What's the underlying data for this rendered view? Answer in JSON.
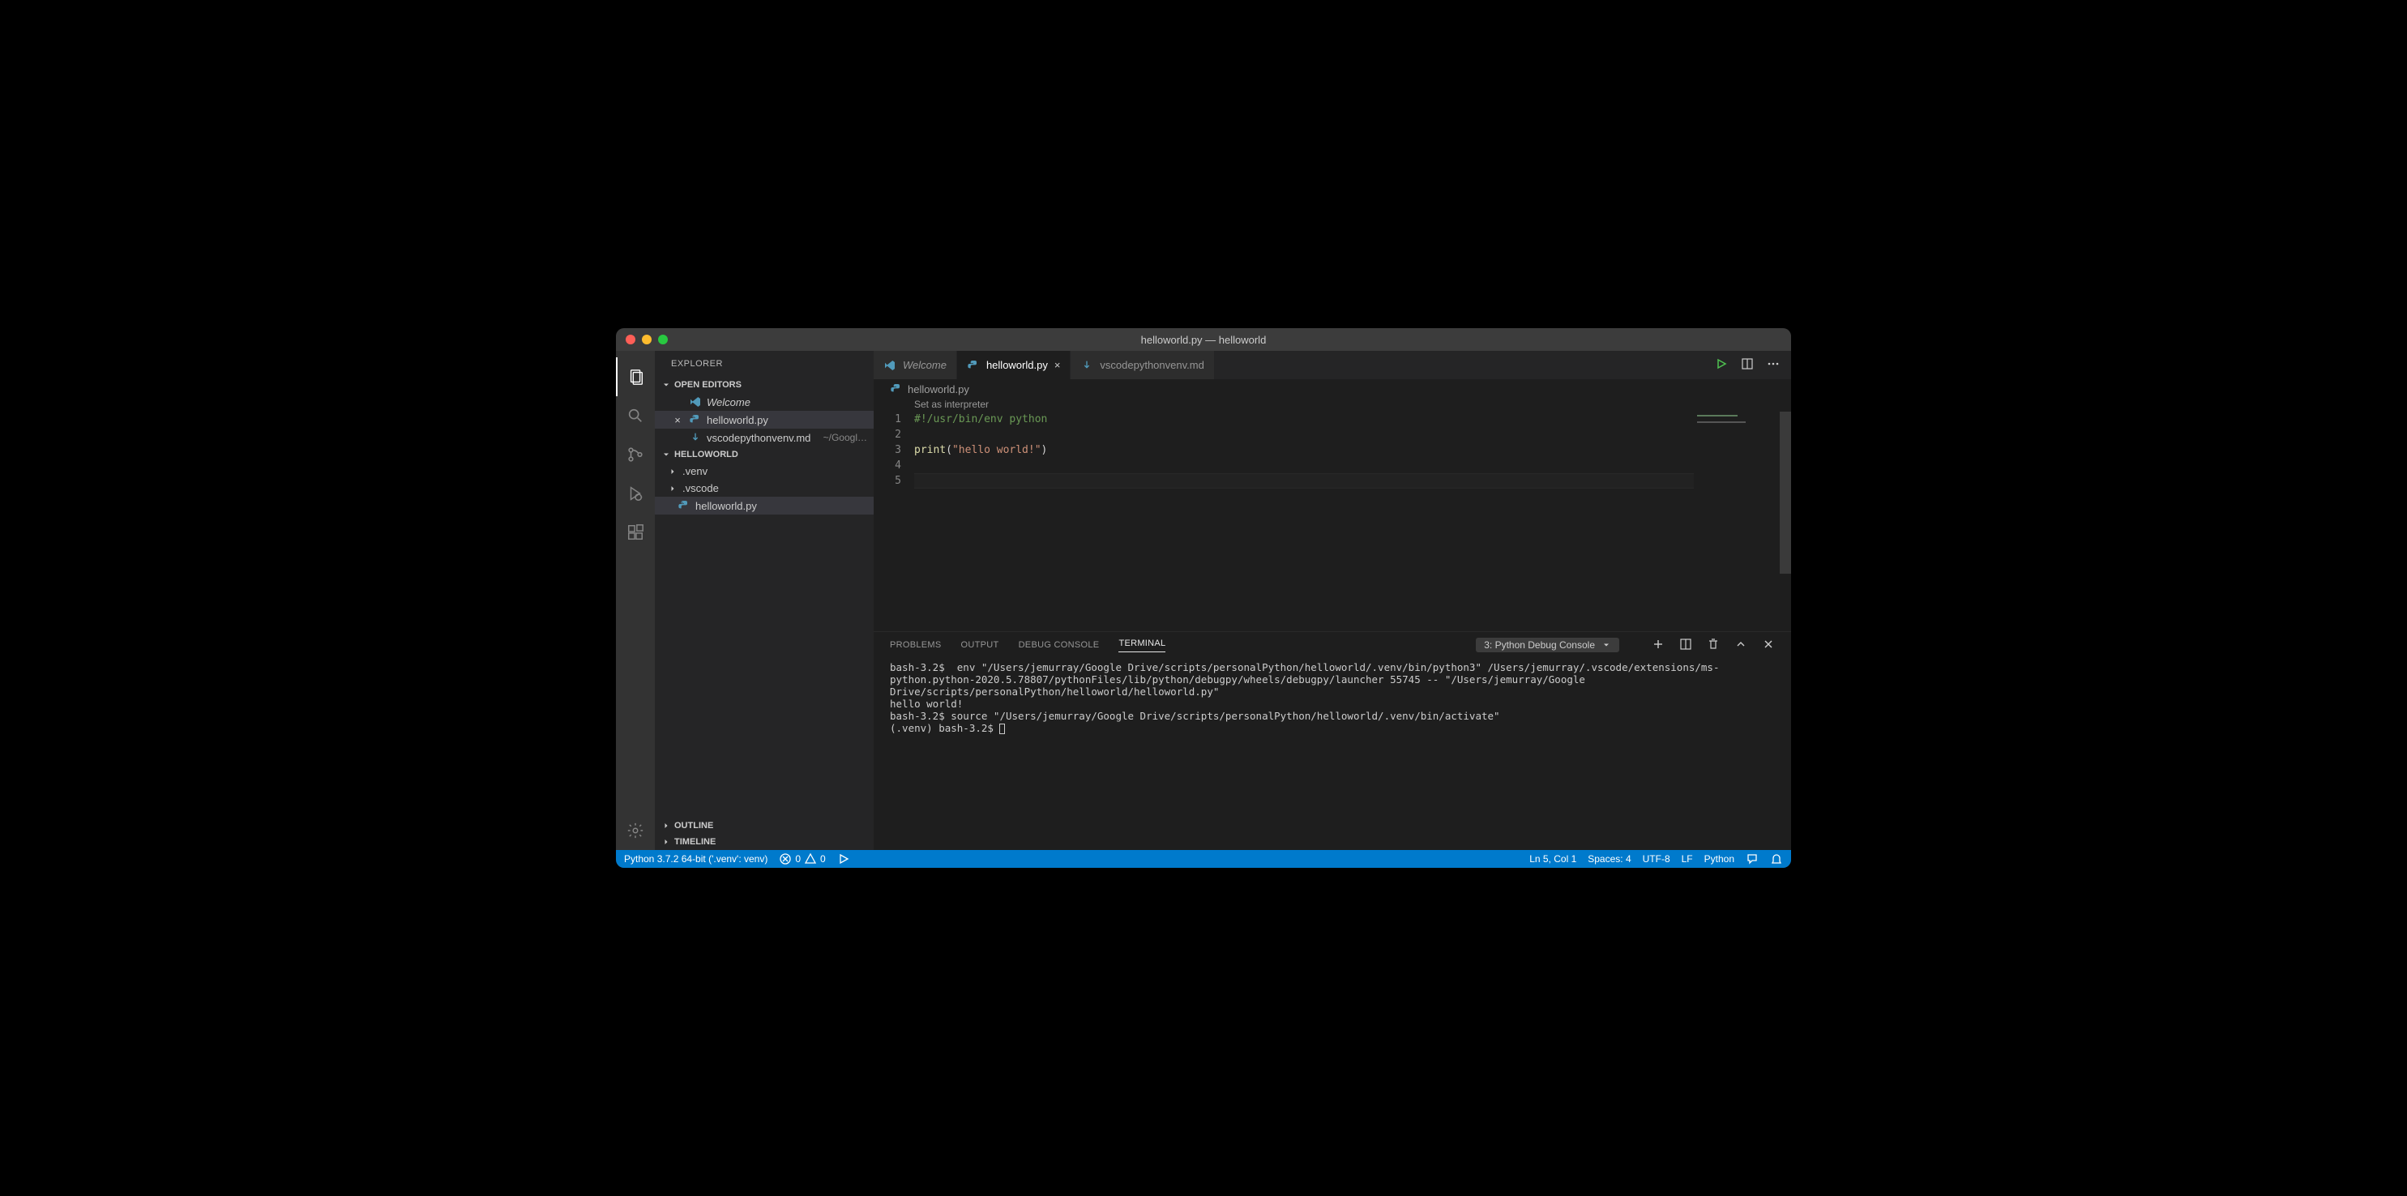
{
  "window_title": "helloworld.py — helloworld",
  "activity": {
    "items": [
      "explorer",
      "search",
      "source-control",
      "debug",
      "extensions"
    ],
    "bottom": [
      "settings"
    ]
  },
  "sidebar": {
    "title": "EXPLORER",
    "openEditorsHeader": "OPEN EDITORS",
    "openEditors": [
      {
        "label": "Welcome",
        "icon": "vscode",
        "italic": true,
        "active": false
      },
      {
        "label": "helloworld.py",
        "icon": "python",
        "italic": false,
        "active": true
      },
      {
        "label": "vscodepythonvenv.md",
        "icon": "markdown",
        "path": "~/Googl…",
        "italic": false,
        "active": false
      }
    ],
    "folderHeader": "HELLOWORLD",
    "tree": [
      {
        "label": ".venv",
        "kind": "folder",
        "expanded": false
      },
      {
        "label": ".vscode",
        "kind": "folder",
        "expanded": false
      },
      {
        "label": "helloworld.py",
        "kind": "file",
        "icon": "python",
        "active": true
      }
    ],
    "outline": "OUTLINE",
    "timeline": "TIMELINE"
  },
  "tabs": [
    {
      "label": "Welcome",
      "icon": "vscode",
      "active": false,
      "italic": true
    },
    {
      "label": "helloworld.py",
      "icon": "python",
      "active": true,
      "italic": false
    },
    {
      "label": "vscodepythonvenv.md",
      "icon": "markdown",
      "active": false,
      "italic": false
    }
  ],
  "breadcrumb": {
    "file": "helloworld.py"
  },
  "codelens": "Set as interpreter",
  "code": {
    "lines": [
      "1",
      "2",
      "3",
      "4",
      "5"
    ],
    "l1_comment": "#!/usr/bin/env python",
    "l3_func": "print",
    "l3_open": "(",
    "l3_str": "\"hello world!\"",
    "l3_close": ")"
  },
  "panel": {
    "tabs": [
      "PROBLEMS",
      "OUTPUT",
      "DEBUG CONSOLE",
      "TERMINAL"
    ],
    "activeTab": 3,
    "terminalSelector": "3: Python Debug Console",
    "terminalText": "bash-3.2$  env \"/Users/jemurray/Google Drive/scripts/personalPython/helloworld/.venv/bin/python3\" /Users/jemurray/.vscode/extensions/ms-python.python-2020.5.78807/pythonFiles/lib/python/debugpy/wheels/debugpy/launcher 55745 -- \"/Users/jemurray/Google Drive/scripts/personalPython/helloworld/helloworld.py\"\nhello world!\nbash-3.2$ source \"/Users/jemurray/Google Drive/scripts/personalPython/helloworld/.venv/bin/activate\"\n(.venv) bash-3.2$ "
  },
  "status": {
    "python": "Python 3.7.2 64-bit ('.venv': venv)",
    "errors": "0",
    "warnings": "0",
    "line_col": "Ln 5, Col 1",
    "spaces": "Spaces: 4",
    "encoding": "UTF-8",
    "eol": "LF",
    "language": "Python"
  }
}
